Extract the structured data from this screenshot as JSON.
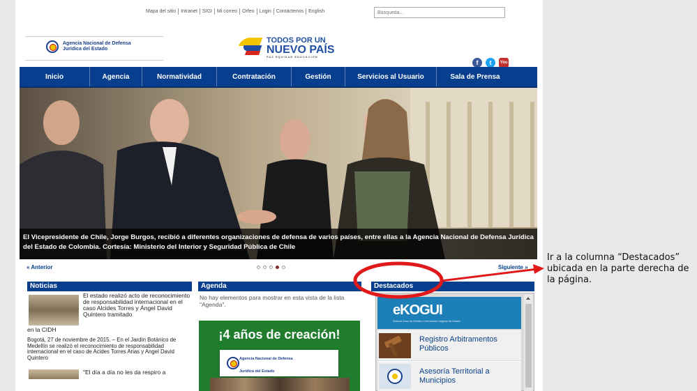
{
  "toplinks": [
    "Mapa del sitio",
    "Intranet",
    "SIGI",
    "Mi correo",
    "Orfeo",
    "Login",
    "Contáctenos",
    "English"
  ],
  "search": {
    "placeholder": "Búsqueda..."
  },
  "header": {
    "agency_line1": "Agencia Nacional de Defensa",
    "agency_line2": "Jurídica del Estado",
    "gov_line1": "TODOS POR UN",
    "gov_line2": "NUEVO PAÍS",
    "gov_line3": "PAZ  EQUIDAD  EDUCACIÓN",
    "social": [
      "facebook-icon",
      "twitter-icon",
      "youtube-icon"
    ]
  },
  "nav": [
    "Inicio",
    "Agencia",
    "Normatividad",
    "Contratación",
    "Gestión",
    "Servicios al Usuario",
    "Sala de Prensa"
  ],
  "hero": {
    "caption": "El Vicepresidente de Chile, Jorge Burgos, recibió a diferentes organizaciones de defensa de varios países, entre ellas a la Agencia Nacional de Defensa Jurídica del Estado de Colombia. Cortesía: Ministerio del Interior y Seguridad Pública de Chile",
    "prev_label": "Anterior",
    "next_label": "Siguiente",
    "slide_count": 5,
    "active_slide": 4
  },
  "noticias": {
    "title": "Noticias",
    "item1_title_a": "El estado realizó acto de reconocimiento de responsabilidad internacional en el caso Alcides Torres y Ángel David Quintero tramitado",
    "item1_title_b": "en la CIDH",
    "item1_body": "Bogotá, 27 de noviembre de 2015. – En el Jardín Botánico de Medellín se realizó el reconocimiento de responsabilidad internacional en el caso de Acides Torres Arias y Angel David Quintero",
    "item2_title": "\"El día a día no les da respiro a"
  },
  "agenda": {
    "title": "Agenda",
    "empty_text": "No hay elementos para mostrar en esta vista de la lista \"Agenda\".",
    "banner_title": "¡4 años de creación!",
    "banner_card_line1": "Agencia Nacional de Defensa",
    "banner_card_line2": "Jurídica del Estado"
  },
  "destacados": {
    "title": "Destacados",
    "ekogui_logo": "eKOGUI",
    "ekogui_sub": "Sistema Único de Gestión e Información Litigiosa del Estado",
    "items": [
      {
        "line1": "Registro Arbitramentos",
        "line2": "Públicos"
      },
      {
        "line1": "Asesoría Territorial a",
        "line2": "Municipios"
      }
    ]
  },
  "annotation": {
    "text": "Ir a la columna “Destacados” ubicada en la parte derecha de la página."
  },
  "colors": {
    "nav": "#073e8d",
    "annotation": "#e01a1a",
    "agenda_banner": "#207d2e"
  }
}
